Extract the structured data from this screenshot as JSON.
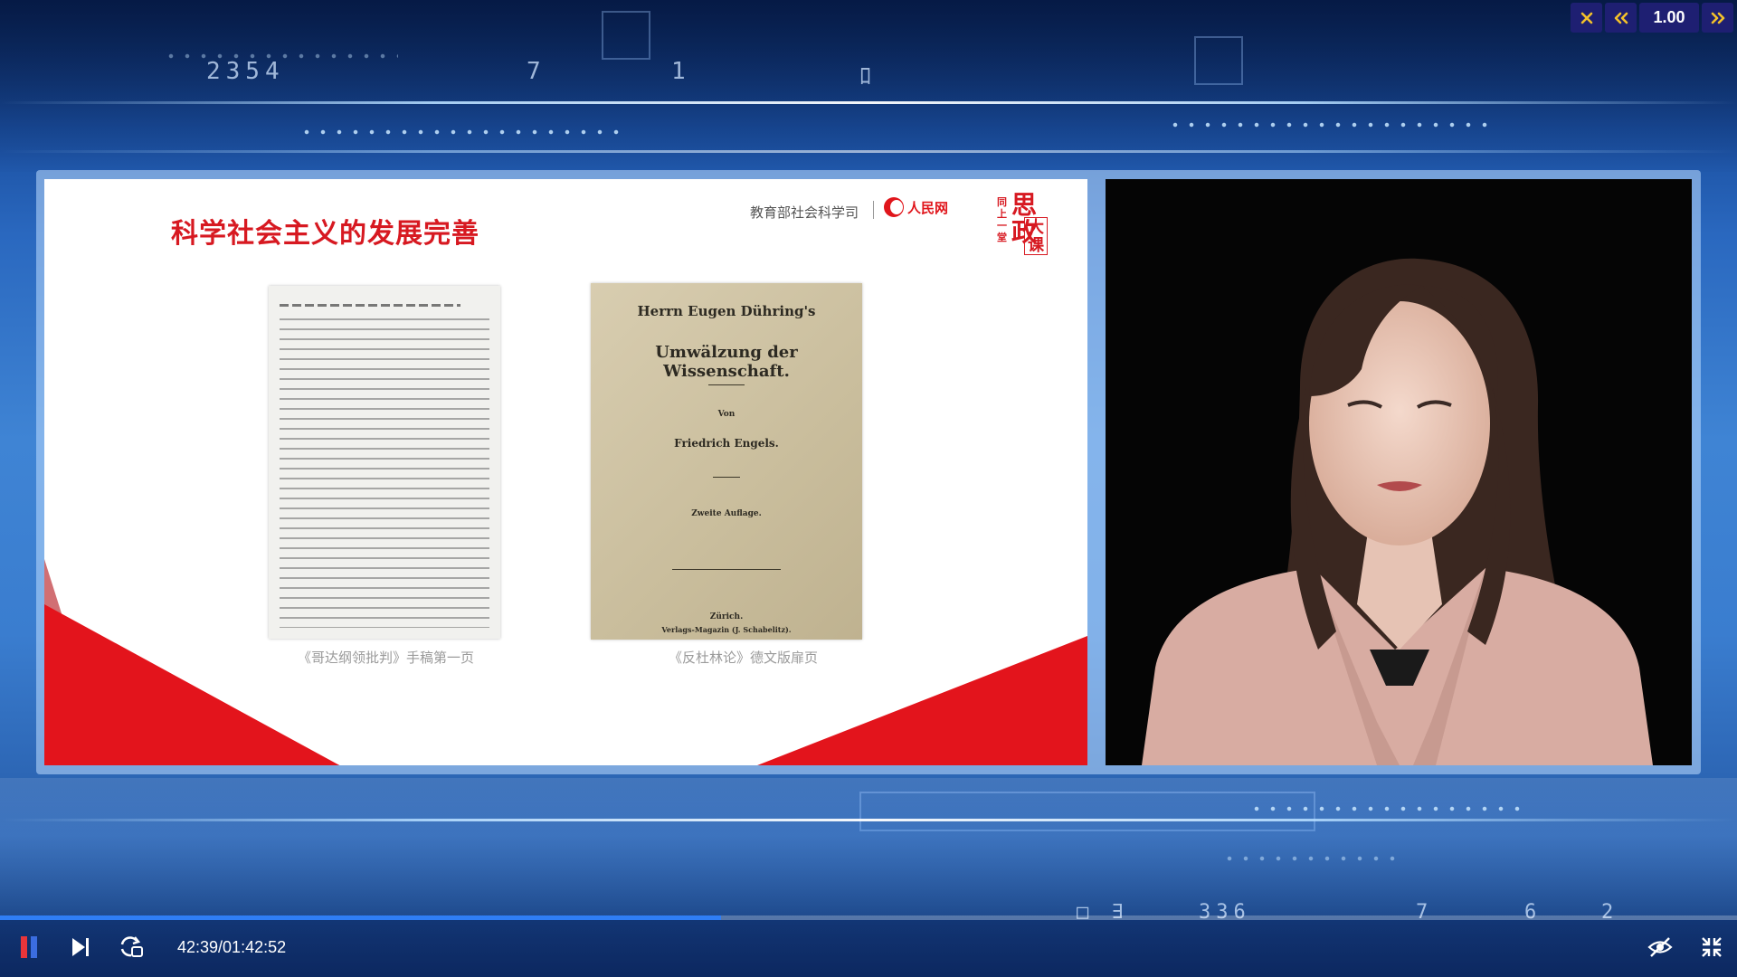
{
  "player": {
    "speed_rate": "1.00",
    "time_display": "42:39/01:42:52",
    "progress": 0.415
  },
  "background": {
    "digits_top": [
      "2354",
      "7",
      "1",
      "ﾛ"
    ],
    "digits_bottom": [
      "□ ∃",
      "336",
      "7",
      "6",
      "2"
    ]
  },
  "slide": {
    "title": "科学社会主义的发展完善",
    "org": "教育部社会科学司",
    "logo_people": "人民网",
    "logo_sizheng_small": "同上一堂",
    "logo_sizheng_big": "思政",
    "logo_sizheng_box": "大课",
    "caption_left": "《哥达纲领批判》手稿第一页",
    "caption_right": "《反杜林论》德文版扉页",
    "book": {
      "line1": "Herrn Eugen Dühring's",
      "line2": "Umwälzung der Wissenschaft.",
      "line3": "Von",
      "line4": "Friedrich Engels.",
      "line5": "Zweite Auflage.",
      "line6": "Zürich.",
      "line7": "Verlags-Magazin (J. Schabelitz)."
    }
  },
  "icons": {
    "close": "close-icon",
    "rewind": "rewind-icon",
    "forward": "fast-forward-icon",
    "pause": "pause-icon",
    "next": "skip-next-icon",
    "loop": "loop-icon",
    "subtitle_off": "subtitle-off-icon",
    "fullscreen_exit": "exit-fullscreen-icon"
  },
  "colors": {
    "accent_yellow": "#f3c22a",
    "speed_bg": "#1e1f72",
    "progress": "#2f7ef5",
    "pause_red": "#e8353a",
    "slide_red": "#d71921"
  }
}
